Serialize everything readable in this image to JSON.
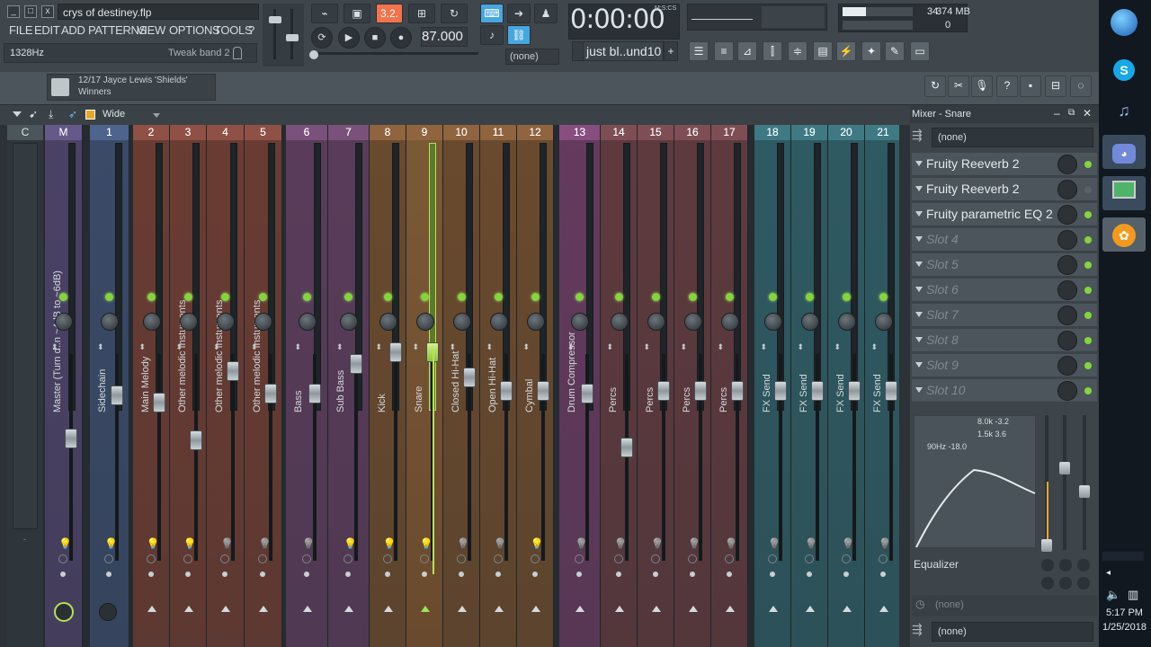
{
  "window": {
    "title": "crys of destiney.flp",
    "min": "_",
    "max": "□",
    "close": "x"
  },
  "menu": [
    "FILE",
    "EDIT",
    "ADD",
    "PATTERNS",
    "VIEW",
    "OPTIONS",
    "TOOLS",
    "?"
  ],
  "hint": {
    "left": "1328Hz",
    "right": "Tweak band 2"
  },
  "transport": {
    "pattern_mode": "3.2.",
    "tempo": "87.000",
    "time": "0:00:00",
    "time_unit": "M:S:CS",
    "pattern": "(none)"
  },
  "pattern_selector": {
    "name": "just bl..und10",
    "add": "+"
  },
  "cpu": {
    "value": "34",
    "memory": "374 MB",
    "polyphony": "0"
  },
  "browser_song": {
    "line1": "12/17  Jayce Lewis 'Shields'",
    "line2": "Winners"
  },
  "mixer_toolbar": {
    "view": "Wide"
  },
  "mixer": {
    "scale": [
      "3",
      "0",
      "3",
      "6",
      "9",
      "12",
      "15",
      "18",
      "21",
      "24",
      "27",
      "33",
      "37",
      "-"
    ],
    "channels": [
      {
        "num": "C",
        "name": "",
        "color": "#4a5a66"
      },
      {
        "num": "M",
        "name": "Master (Turn d..n ~4dB to ~6dB)",
        "color": "#4b4266"
      },
      {
        "num": "1",
        "name": "Sidechain",
        "color": "#3a4a68"
      },
      {
        "num": "2",
        "name": "Main Melody",
        "color": "#6a3c33"
      },
      {
        "num": "3",
        "name": "Other melodic Instuments",
        "color": "#6a3c33"
      },
      {
        "num": "4",
        "name": "Other melodic Instuments",
        "color": "#6a3c33"
      },
      {
        "num": "5",
        "name": "Other melodic Instuments",
        "color": "#6a3c33"
      },
      {
        "num": "6",
        "name": "Bass",
        "color": "#5a3c5a"
      },
      {
        "num": "7",
        "name": "Sub Bass",
        "color": "#5a3c5a"
      },
      {
        "num": "8",
        "name": "Kick",
        "color": "#6a4a2e"
      },
      {
        "num": "9",
        "name": "Snare",
        "color": "#6a4a2e"
      },
      {
        "num": "10",
        "name": "Closed Hi-Hat",
        "color": "#6a4a2e"
      },
      {
        "num": "11",
        "name": "Open Hi-Hat",
        "color": "#6a4a2e"
      },
      {
        "num": "12",
        "name": "Cymbal",
        "color": "#6a4a2e"
      },
      {
        "num": "13",
        "name": "Drum Compressor",
        "color": "#643a5e"
      },
      {
        "num": "14",
        "name": "Percs",
        "color": "#5e3a3e"
      },
      {
        "num": "15",
        "name": "Percs",
        "color": "#5e3a3e"
      },
      {
        "num": "16",
        "name": "Percs",
        "color": "#5e3a3e"
      },
      {
        "num": "17",
        "name": "Percs",
        "color": "#5e3a3e"
      },
      {
        "num": "18",
        "name": "FX Send",
        "color": "#2f5a62"
      },
      {
        "num": "19",
        "name": "FX Send",
        "color": "#2f5a62"
      },
      {
        "num": "20",
        "name": "FX Send",
        "color": "#2f5a62"
      },
      {
        "num": "21",
        "name": "FX Send",
        "color": "#2f5a62"
      }
    ]
  },
  "panel": {
    "title": "Mixer - Snare",
    "input": "(none)",
    "slots": [
      {
        "name": "Fruity Reeverb 2",
        "active": true
      },
      {
        "name": "Fruity Reeverb 2",
        "active": false
      },
      {
        "name": "Fruity parametric EQ 2",
        "active": true
      },
      {
        "name": "Slot 4",
        "active": true
      },
      {
        "name": "Slot 5",
        "active": true
      },
      {
        "name": "Slot 6",
        "active": true
      },
      {
        "name": "Slot 7",
        "active": true
      },
      {
        "name": "Slot 8",
        "active": true
      },
      {
        "name": "Slot 9",
        "active": true
      },
      {
        "name": "Slot 10",
        "active": true
      }
    ],
    "eq_labels": {
      "a": "8.0k -3.2",
      "b": "1.5k 3.6",
      "c": "90Hz -18.0"
    },
    "eq_title": "Equalizer",
    "post": "(none)",
    "output": "(none)"
  },
  "taskbar": {
    "time": "5:17 PM",
    "date": "1/25/2018"
  }
}
